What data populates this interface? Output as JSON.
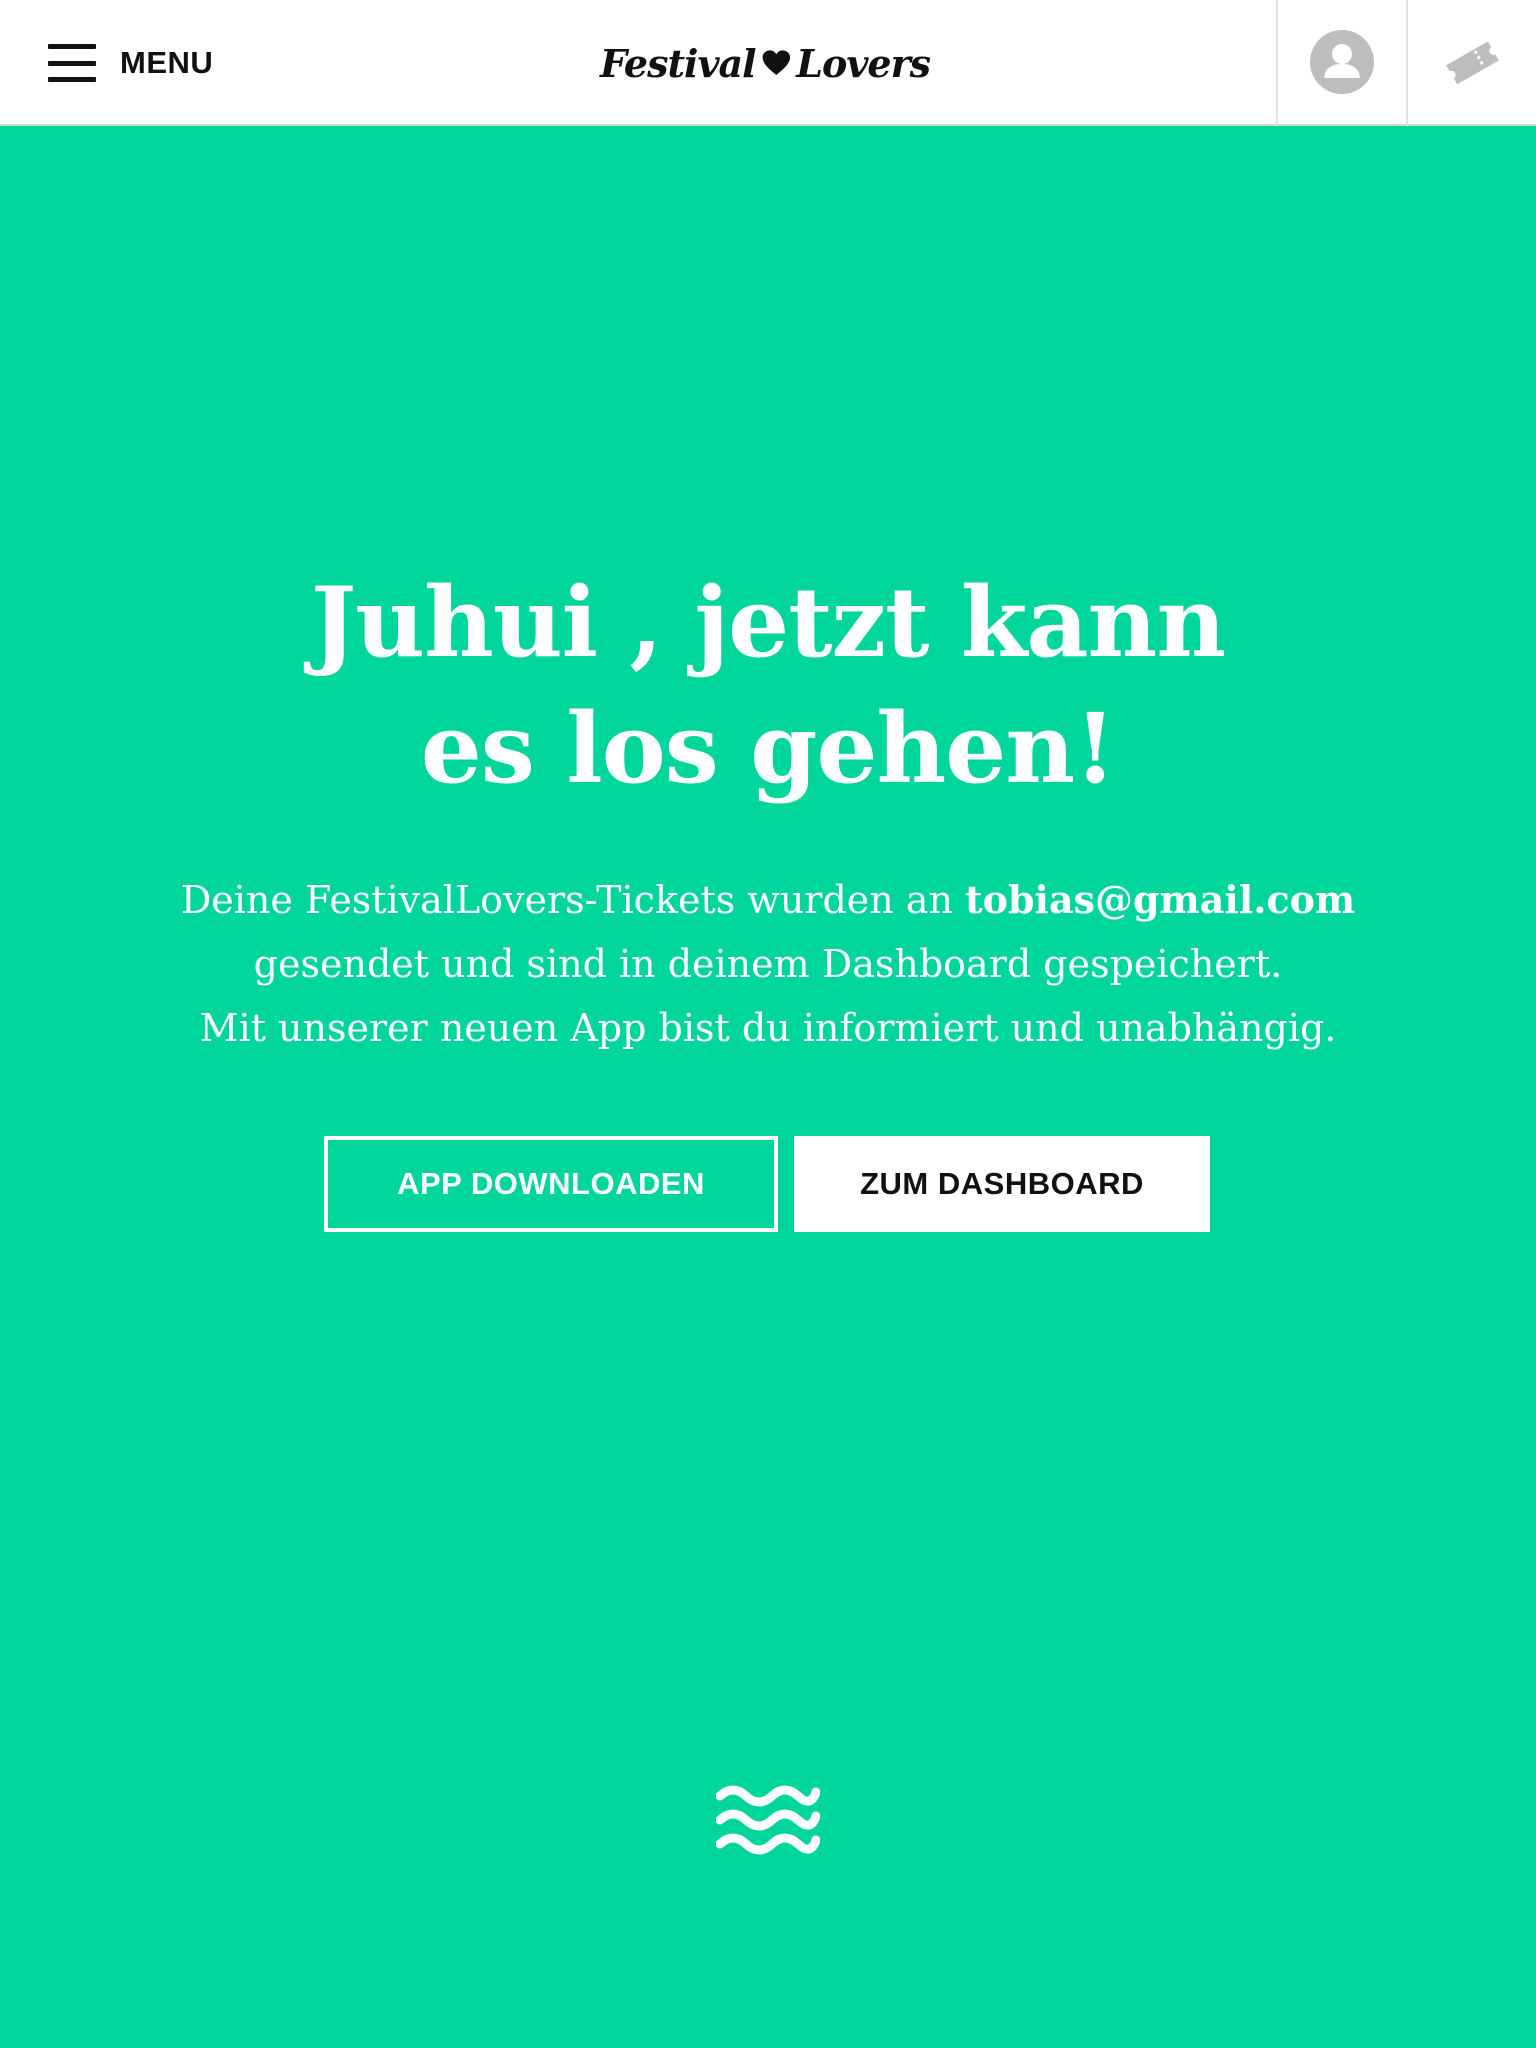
{
  "header": {
    "menu_label": "MENU",
    "logo": {
      "word_left": "Festival",
      "word_right": "Lovers",
      "heart_icon": "heart-icon"
    },
    "account_icon": "user-avatar-icon",
    "ticket_icon": "ticket-icon"
  },
  "hero": {
    "headline_line1": "Juhui , jetzt kann",
    "headline_line2": "es los gehen!",
    "message_prefix": "Deine FestivalLovers-Tickets wurden an ",
    "email": "tobias@gmail.com",
    "message_line2": "gesendet und sind in deinem Dashboard gespeichert.",
    "message_line3": "Mit unserer neuen App bist du informiert und unabhängig.",
    "button_app": "APP DOWNLOADEN",
    "button_dashboard": "ZUM DASHBOARD",
    "scroll_icon": "waves-icon"
  },
  "colors": {
    "background": "#00d69c",
    "header_background": "#ffffff",
    "text_on_background": "#ffffff",
    "dark_text": "#111111",
    "icon_grey": "#bdbdbd"
  }
}
